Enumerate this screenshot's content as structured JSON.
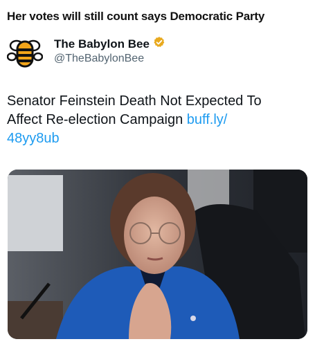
{
  "post": {
    "caption": "Her votes will still count says Democratic Party",
    "author_name": "The Babylon Bee",
    "author_handle": "@TheBabylonBee",
    "text": "Senator Feinstein Death Not Expected To Affect Re-election Campaign",
    "link_line1": "buff.ly/",
    "link_line2": "48yy8ub"
  },
  "icons": {
    "avatar": "bee-logo-icon",
    "verified": "verified-badge-icon"
  },
  "colors": {
    "link": "#1d9bf0",
    "verified": "#e8a91e",
    "bee_stripe": "#f2a51a",
    "jacket": "#1e5bb8"
  }
}
